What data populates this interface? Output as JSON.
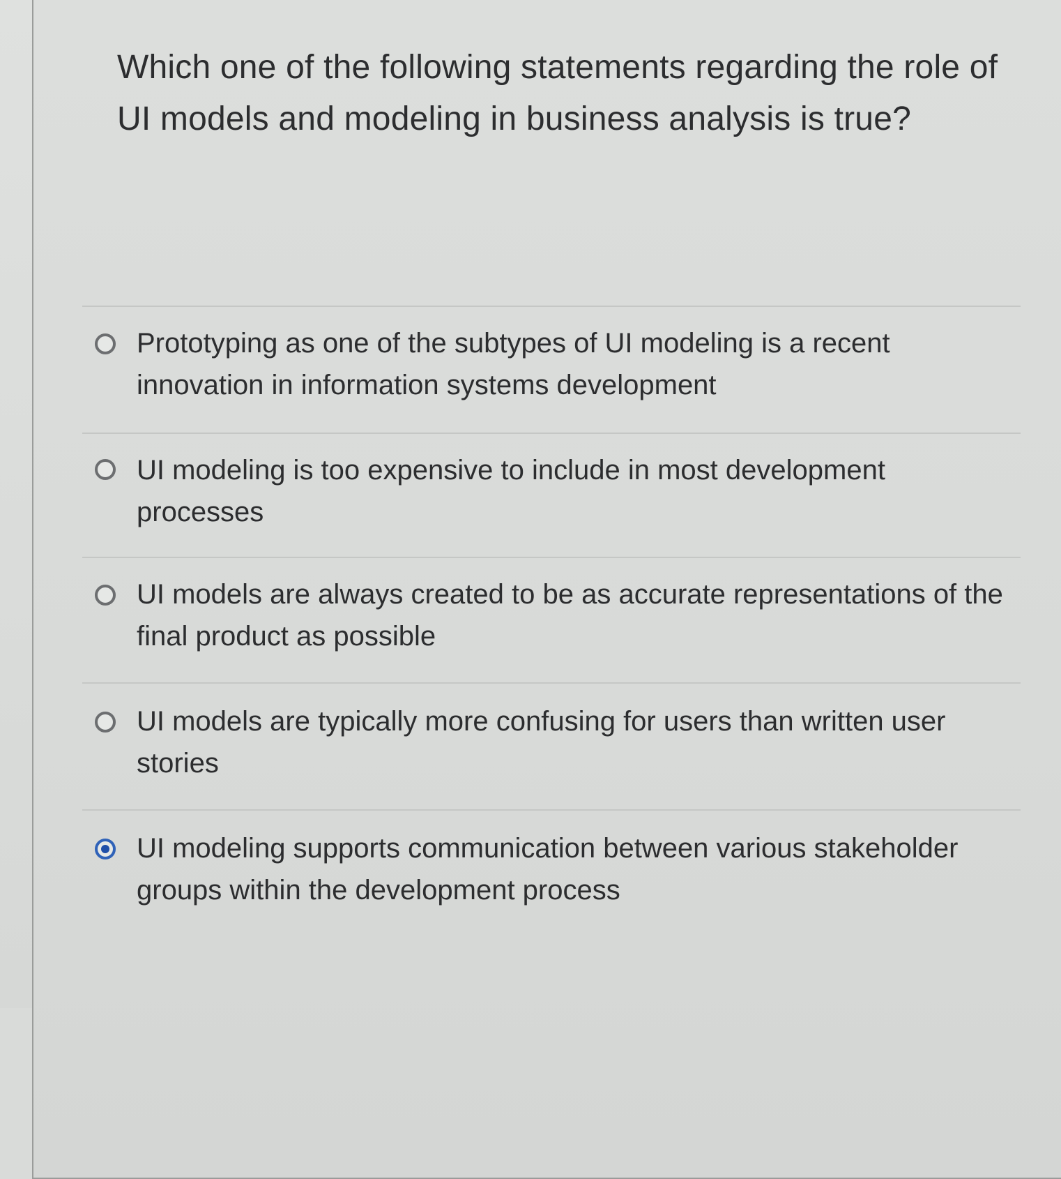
{
  "question": {
    "text": "Which one of the following statements regarding the role of UI models and modeling in business analysis is true?"
  },
  "answers": [
    {
      "label": "Prototyping as one of the subtypes of UI modeling is a recent innovation in information systems development",
      "selected": false
    },
    {
      "label": "UI modeling is too expensive to include in most development processes",
      "selected": false
    },
    {
      "label": "UI models are always created to be as accurate representations of the final product as possible",
      "selected": false
    },
    {
      "label": "UI models are typically more confusing for users than written user stories",
      "selected": false
    },
    {
      "label": "UI modeling supports communication between various stakeholder groups within the development process",
      "selected": true
    }
  ],
  "colors": {
    "selected_radio": "#2f62b8",
    "text": "#2c2d2f",
    "background": "#dcdedc"
  }
}
